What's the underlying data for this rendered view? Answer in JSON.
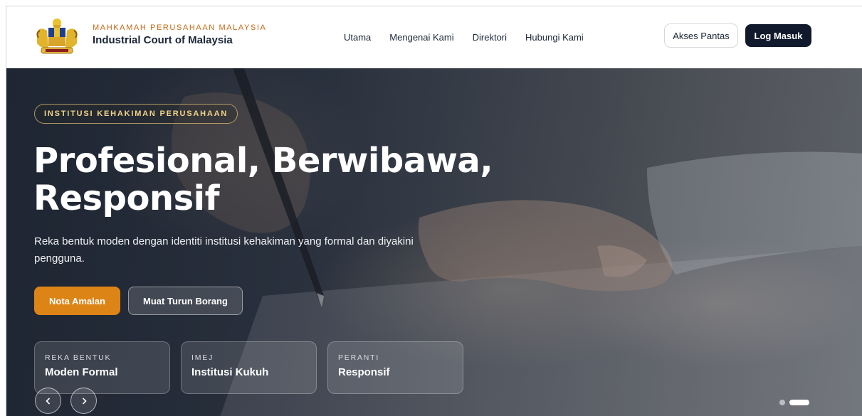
{
  "header": {
    "brand_top": "MAHKAMAH PERUSAHAAN MALAYSIA",
    "brand_bottom": "Industrial Court of Malaysia",
    "nav": [
      "Utama",
      "Mengenai Kami",
      "Direktori",
      "Hubungi Kami"
    ],
    "quick_access": "Akses Pantas",
    "login": "Log Masuk"
  },
  "hero": {
    "badge": "INSTITUSI KEHAKIMAN PERUSAHAAN",
    "title_line1": "Profesional, Berwibawa,",
    "title_line2": "Responsif",
    "subtitle": "Reka bentuk moden dengan identiti institusi kehakiman yang formal dan diyakini pengguna.",
    "primary_button": "Nota Amalan",
    "secondary_button": "Muat Turun Borang",
    "cards": [
      {
        "key": "REKA BENTUK",
        "value": "Moden Formal"
      },
      {
        "key": "IMEJ",
        "value": "Institusi Kukuh"
      },
      {
        "key": "PERANTI",
        "value": "Responsif"
      }
    ],
    "prev_icon": "chevron-left-icon",
    "next_icon": "chevron-right-icon",
    "slides_total": 2,
    "slide_active": 2
  },
  "colors": {
    "brand_orange": "#c26a16",
    "primary_button": "#dd8417",
    "login_button": "#111a2c",
    "badge_gold": "#f1d48b"
  }
}
